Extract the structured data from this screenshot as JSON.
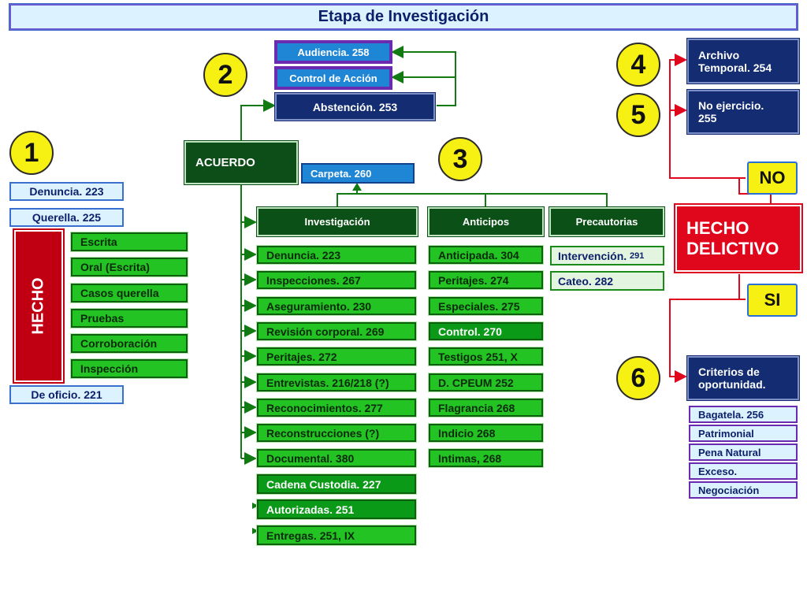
{
  "title": "Etapa de Investigación",
  "steps": [
    "1",
    "2",
    "3",
    "4",
    "5",
    "6"
  ],
  "acuerdo": "ACUERDO",
  "carpeta": "Carpeta. 260",
  "top_boxes": {
    "audiencia": "Audiencia. 258",
    "control": "Control de Acción",
    "abstencion": "Abstención. 253"
  },
  "left": {
    "denuncia": "Denuncia. 223",
    "querella": "Querella. 225",
    "hecho": "HECHO",
    "items": [
      "Escrita",
      "Oral (Escrita)",
      "Casos querella",
      "Pruebas",
      "Corroboración",
      "Inspección"
    ],
    "de_oficio": "De oficio. 221"
  },
  "headers": {
    "investigacion": "Investigación",
    "anticipos": "Anticipos",
    "precautorias": "Precautorias"
  },
  "investigacion_items": [
    "Denuncia. 223",
    "Inspecciones. 267",
    "Aseguramiento. 230",
    "Revisión corporal. 269",
    "Peritajes. 272",
    "Entrevistas. 216/218 (?)",
    "Reconocimientos. 277",
    "Reconstrucciones (?)",
    "Documental. 380"
  ],
  "investigacion_extra": [
    "Cadena Custodia. 227",
    "Autorizadas. 251",
    "Entregas. 251, IX"
  ],
  "anticipos_items": [
    "Anticipada. 304",
    "Peritajes. 274",
    "Especiales. 275",
    "Control. 270",
    "Testigos 251, X",
    "D. CPEUM 252",
    "Flagrancia 268",
    "Indicio 268",
    "Intimas, 268"
  ],
  "precautorias": {
    "intervencion": "Intervención.",
    "intervencion_num": "291",
    "cateo": "Cateo. 282"
  },
  "right": {
    "archivo": [
      "Archivo",
      "Temporal. 254"
    ],
    "no_ejercicio": [
      "No ejercicio.",
      "255"
    ],
    "no": "NO",
    "si": "SI",
    "hecho_delictivo": [
      "HECHO",
      "DELICTIVO"
    ],
    "criterios": [
      "Criterios de",
      "oportunidad."
    ],
    "criterios_items": [
      "Bagatela. 256",
      "Patrimonial",
      "Pena Natural",
      "Exceso.",
      "Negociación"
    ]
  },
  "colors": {
    "dark_green": "#0d4d17",
    "green": "#22c322",
    "navy": "#132c72",
    "red": "#e0061c",
    "yellow": "#f6f013",
    "light_blue": "#dcf2ff",
    "purple": "#6a2bb0"
  }
}
